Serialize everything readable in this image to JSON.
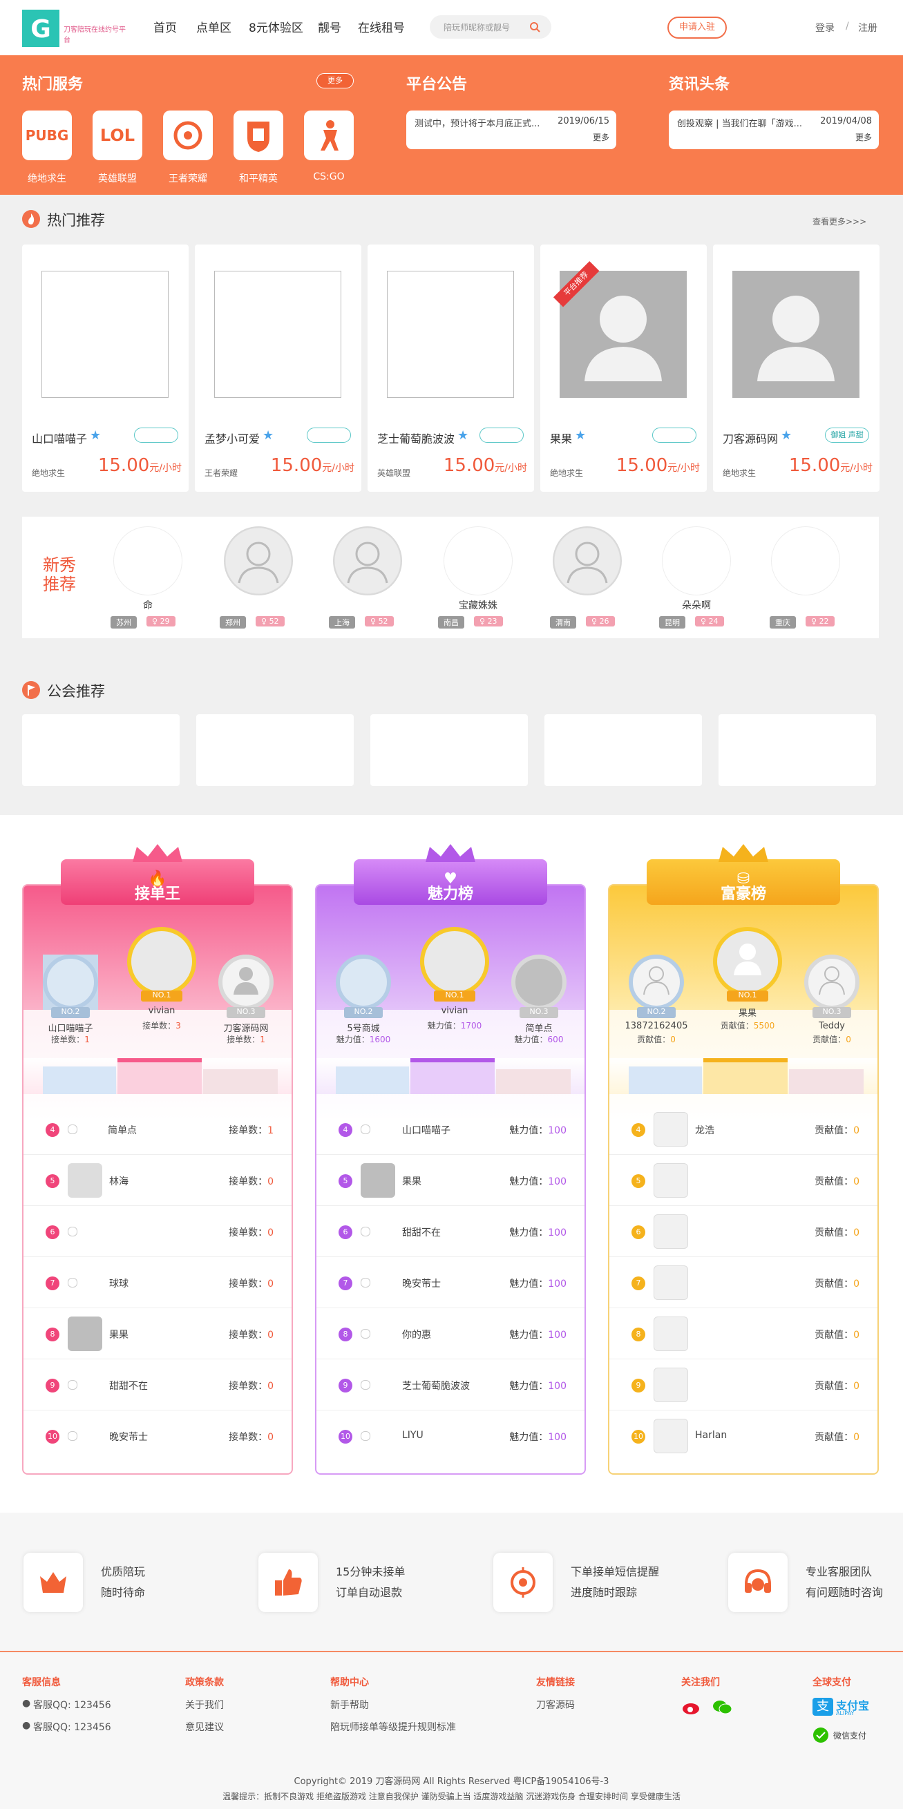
{
  "brand": {
    "accent": "#f97c4d",
    "accent_dark": "#f05a3c",
    "logo_text": "刀客陪玩在线约号平台"
  },
  "nav": {
    "items": [
      "首页",
      "点单区",
      "8元体验区",
      "靓号",
      "在线租号"
    ]
  },
  "search": {
    "placeholder": "陪玩师昵称或靓号"
  },
  "header": {
    "apply": "申请入驻",
    "login": "登录",
    "sep": "/",
    "register": "注册"
  },
  "hot_services": {
    "title": "热门服务",
    "more": "更多",
    "games": [
      {
        "icon": "PUBG",
        "label": "绝地求生"
      },
      {
        "icon": "LOL",
        "label": "英雄联盟"
      },
      {
        "icon": "wzry-icon",
        "label": "王者荣耀"
      },
      {
        "icon": "hpjy-icon",
        "label": "和平精英"
      },
      {
        "icon": "csgo-icon",
        "label": "CS:GO"
      }
    ]
  },
  "notice": {
    "title": "平台公告",
    "text": "测试中，预计将于本月底正式...",
    "date": "2019/06/15",
    "more": "更多"
  },
  "news": {
    "title": "资讯头条",
    "text": "创投观察 | 当我们在聊「游戏...",
    "date": "2019/04/08",
    "more": "更多"
  },
  "hot_rec": {
    "title": "热门推荐",
    "more": "查看更多>>>",
    "unit": "元/小时",
    "cards": [
      {
        "name": "山口喵喵子",
        "game": "绝地求生",
        "price": "15.00",
        "tag": "",
        "badge": ""
      },
      {
        "name": "孟梦小可爱",
        "game": "王者荣耀",
        "price": "15.00",
        "tag": "",
        "badge": ""
      },
      {
        "name": "芝士葡萄脆波波",
        "game": "英雄联盟",
        "price": "15.00",
        "tag": "",
        "badge": ""
      },
      {
        "name": "果果",
        "game": "绝地求生",
        "price": "15.00",
        "tag": "",
        "badge": "平台推荐"
      },
      {
        "name": "刀客源码网",
        "game": "绝地求生",
        "price": "15.00",
        "tag": "御姐 声甜",
        "badge": ""
      }
    ]
  },
  "new_rec": {
    "title": "新秀推荐",
    "items": [
      {
        "name": "命",
        "city": "苏州",
        "n": "29"
      },
      {
        "name": "",
        "city": "郑州",
        "n": "52"
      },
      {
        "name": "",
        "city": "上海",
        "n": "52"
      },
      {
        "name": "宝藏姝姝",
        "city": "南昌",
        "n": "23"
      },
      {
        "name": "",
        "city": "渭南",
        "n": "26"
      },
      {
        "name": "朵朵啊",
        "city": "昆明",
        "n": "24"
      },
      {
        "name": "",
        "city": "重庆",
        "n": "22"
      }
    ]
  },
  "guild": {
    "title": "公会推荐"
  },
  "rank_orders": {
    "title": "接单王",
    "label": "接单数：",
    "color": "#f0457a",
    "top": [
      {
        "pos": "NO.2",
        "name": "山口喵喵子",
        "val": "1"
      },
      {
        "pos": "NO.1",
        "name": "vivian",
        "val": "3"
      },
      {
        "pos": "NO.3",
        "name": "刀客源码网",
        "val": "1"
      }
    ],
    "rows": [
      {
        "rk": "4",
        "name": "简单点",
        "val": "1"
      },
      {
        "rk": "5",
        "name": "林海",
        "val": "0"
      },
      {
        "rk": "6",
        "name": "",
        "val": "0"
      },
      {
        "rk": "7",
        "name": "球球",
        "val": "0"
      },
      {
        "rk": "8",
        "name": "果果",
        "val": "0"
      },
      {
        "rk": "9",
        "name": "甜甜不在",
        "val": "0"
      },
      {
        "rk": "10",
        "name": "晚安芾士",
        "val": "0"
      }
    ]
  },
  "rank_charm": {
    "title": "魅力榜",
    "label": "魅力值：",
    "color": "#b258e8",
    "top": [
      {
        "pos": "NO.2",
        "name": "5号商城",
        "val": "1600"
      },
      {
        "pos": "NO.1",
        "name": "vivian",
        "val": "1700"
      },
      {
        "pos": "NO.3",
        "name": "简单点",
        "val": "600"
      }
    ],
    "rows": [
      {
        "rk": "4",
        "name": "山口喵喵子",
        "val": "100"
      },
      {
        "rk": "5",
        "name": "果果",
        "val": "100"
      },
      {
        "rk": "6",
        "name": "甜甜不在",
        "val": "100"
      },
      {
        "rk": "7",
        "name": "晚安芾士",
        "val": "100"
      },
      {
        "rk": "8",
        "name": "你的惠",
        "val": "100"
      },
      {
        "rk": "9",
        "name": "芝士葡萄脆波波",
        "val": "100"
      },
      {
        "rk": "10",
        "name": "LIYU",
        "val": "100"
      }
    ]
  },
  "rank_rich": {
    "title": "富豪榜",
    "label": "贡献值：",
    "color": "#f5b21c",
    "top": [
      {
        "pos": "NO.2",
        "name": "13872162405",
        "val": "0"
      },
      {
        "pos": "NO.1",
        "name": "果果",
        "val": "5500"
      },
      {
        "pos": "NO.3",
        "name": "Teddy",
        "val": "0"
      }
    ],
    "rows": [
      {
        "rk": "4",
        "name": "龙浩",
        "val": "0"
      },
      {
        "rk": "5",
        "name": "",
        "val": "0"
      },
      {
        "rk": "6",
        "name": "",
        "val": "0"
      },
      {
        "rk": "7",
        "name": "",
        "val": "0"
      },
      {
        "rk": "8",
        "name": "",
        "val": "0"
      },
      {
        "rk": "9",
        "name": "",
        "val": "0"
      },
      {
        "rk": "10",
        "name": "Harlan",
        "val": "0"
      }
    ]
  },
  "features": [
    {
      "l1": "优质陪玩",
      "l2": "随时待命"
    },
    {
      "l1": "15分钟未接单",
      "l2": "订单自动退款"
    },
    {
      "l1": "下单接单短信提醒",
      "l2": "进度随时跟踪"
    },
    {
      "l1": "专业客服团队",
      "l2": "有问题随时咨询"
    }
  ],
  "footer": {
    "c1": {
      "h": "客服信息",
      "a": "客服QQ: 123456",
      "b": "客服QQ: 123456"
    },
    "c2": {
      "h": "政策条款",
      "a": "关于我们",
      "b": "意见建议"
    },
    "c3": {
      "h": "帮助中心",
      "a": "新手帮助",
      "b": "陪玩师接单等级提升规则标准"
    },
    "c4": {
      "h": "友情链接",
      "a": "刀客源码"
    },
    "c5": {
      "h": "关注我们"
    },
    "c6": {
      "h": "全球支付",
      "alipay": "支付宝",
      "alipay_en": "ALIPAY",
      "wechat": "微信支付"
    },
    "copyright": "Copyright© 2019 刀客源码网 All Rights Reserved 粤ICP备19054106号-3",
    "tip": "温馨提示：抵制不良游戏 拒绝盗版游戏 注意自我保护 谨防受骗上当 适度游戏益脑 沉迷游戏伤身 合理安排时间 享受健康生活"
  }
}
